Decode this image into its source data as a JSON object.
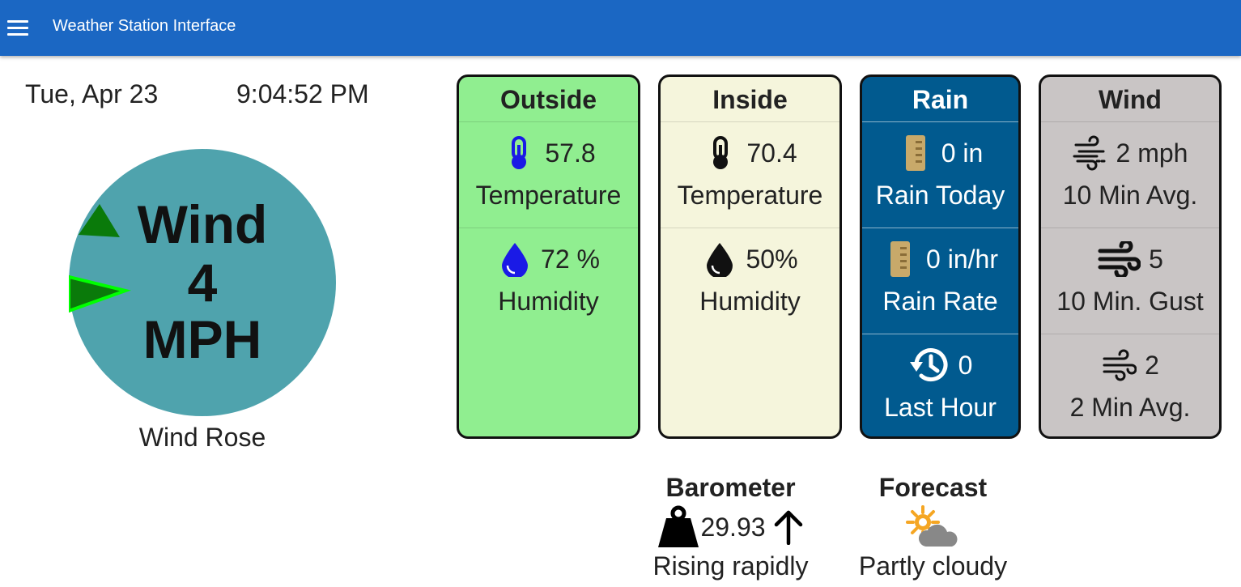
{
  "app": {
    "title": "Weather Station Interface",
    "menu_icon": "hamburger-menu-icon"
  },
  "header": {
    "date": "Tue, Apr 23",
    "time": "9:04:52 PM"
  },
  "wind_rose": {
    "line1": "Wind",
    "line2": "4",
    "line3": "MPH",
    "caption": "Wind Rose",
    "disc_color": "#4fa3ad",
    "marker_colors": [
      "#0a7a0a",
      "#00ff00"
    ]
  },
  "outside": {
    "title": "Outside",
    "color": "#90ee90",
    "temperature": {
      "value": "57.8",
      "label": "Temperature",
      "icon": "thermometer-icon"
    },
    "humidity": {
      "value": "72 %",
      "label": "Humidity",
      "icon": "water-drop-icon"
    }
  },
  "inside": {
    "title": "Inside",
    "color": "#f5f5dc",
    "temperature": {
      "value": "70.4",
      "label": "Temperature",
      "icon": "thermometer-icon"
    },
    "humidity": {
      "value": "50%",
      "label": "Humidity",
      "icon": "water-drop-icon"
    }
  },
  "rain": {
    "title": "Rain",
    "color": "#015a8f",
    "today": {
      "value": "0 in",
      "label": "Rain Today",
      "icon": "rain-gauge-icon"
    },
    "rate": {
      "value": "0 in/hr",
      "label": "Rain Rate",
      "icon": "rain-gauge-icon"
    },
    "last_hour": {
      "value": "0",
      "label": "Last Hour",
      "icon": "history-icon"
    }
  },
  "wind": {
    "title": "Wind",
    "color": "#c9c5c5",
    "avg10": {
      "value": "2 mph",
      "label": "10 Min Avg.",
      "icon": "wind-icon"
    },
    "gust10": {
      "value": "5",
      "label": "10 Min. Gust",
      "icon": "strong-wind-icon"
    },
    "avg2": {
      "value": "2",
      "label": "2 Min Avg.",
      "icon": "wind-icon"
    }
  },
  "barometer": {
    "title": "Barometer",
    "value": "29.93",
    "trend": "Rising rapidly",
    "icon": "weight-icon",
    "trend_icon": "arrow-up-icon"
  },
  "forecast": {
    "title": "Forecast",
    "text": "Partly cloudy",
    "icon": "partly-cloudy-icon"
  }
}
